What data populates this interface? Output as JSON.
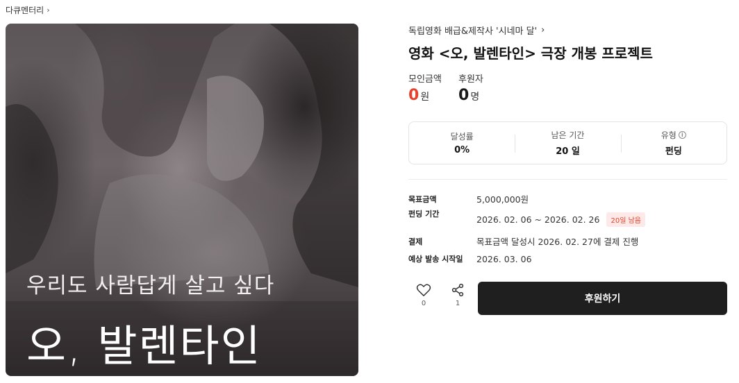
{
  "breadcrumb": {
    "label": "다큐멘터리"
  },
  "poster": {
    "tagline": "우리도 사람답게 살고 싶다",
    "title": "오, 발렌타인"
  },
  "project": {
    "creator": "독립영화 배급&제작사 '시네마 달'",
    "title": "영화 <오, 발렌타인> 극장 개봉 프로젝트"
  },
  "stats": {
    "raised_label": "모인금액",
    "raised_value": "0",
    "raised_unit": "원",
    "backers_label": "후원자",
    "backers_value": "0",
    "backers_unit": "명"
  },
  "summary": {
    "rate_label": "달성률",
    "rate_value": "0%",
    "remaining_label": "남은 기간",
    "remaining_value": "20 일",
    "type_label": "유형",
    "type_value": "펀딩"
  },
  "details": {
    "goal_label": "목표금액",
    "goal_value": "5,000,000원",
    "period_label": "펀딩 기간",
    "period_value": "2026. 02. 06 ~ 2026. 02. 26",
    "period_badge": "20일 남음",
    "payment_label": "결제",
    "payment_value": "목표금액 달성시 2026. 02. 27에 결제 진행",
    "delivery_label": "예상 발송 시작일",
    "delivery_value": "2026. 03. 06"
  },
  "actions": {
    "like_count": "0",
    "share_count": "1",
    "support_label": "후원하기"
  },
  "colors": {
    "accent_red": "#e5432e",
    "button_dark": "#1f1f1f"
  }
}
